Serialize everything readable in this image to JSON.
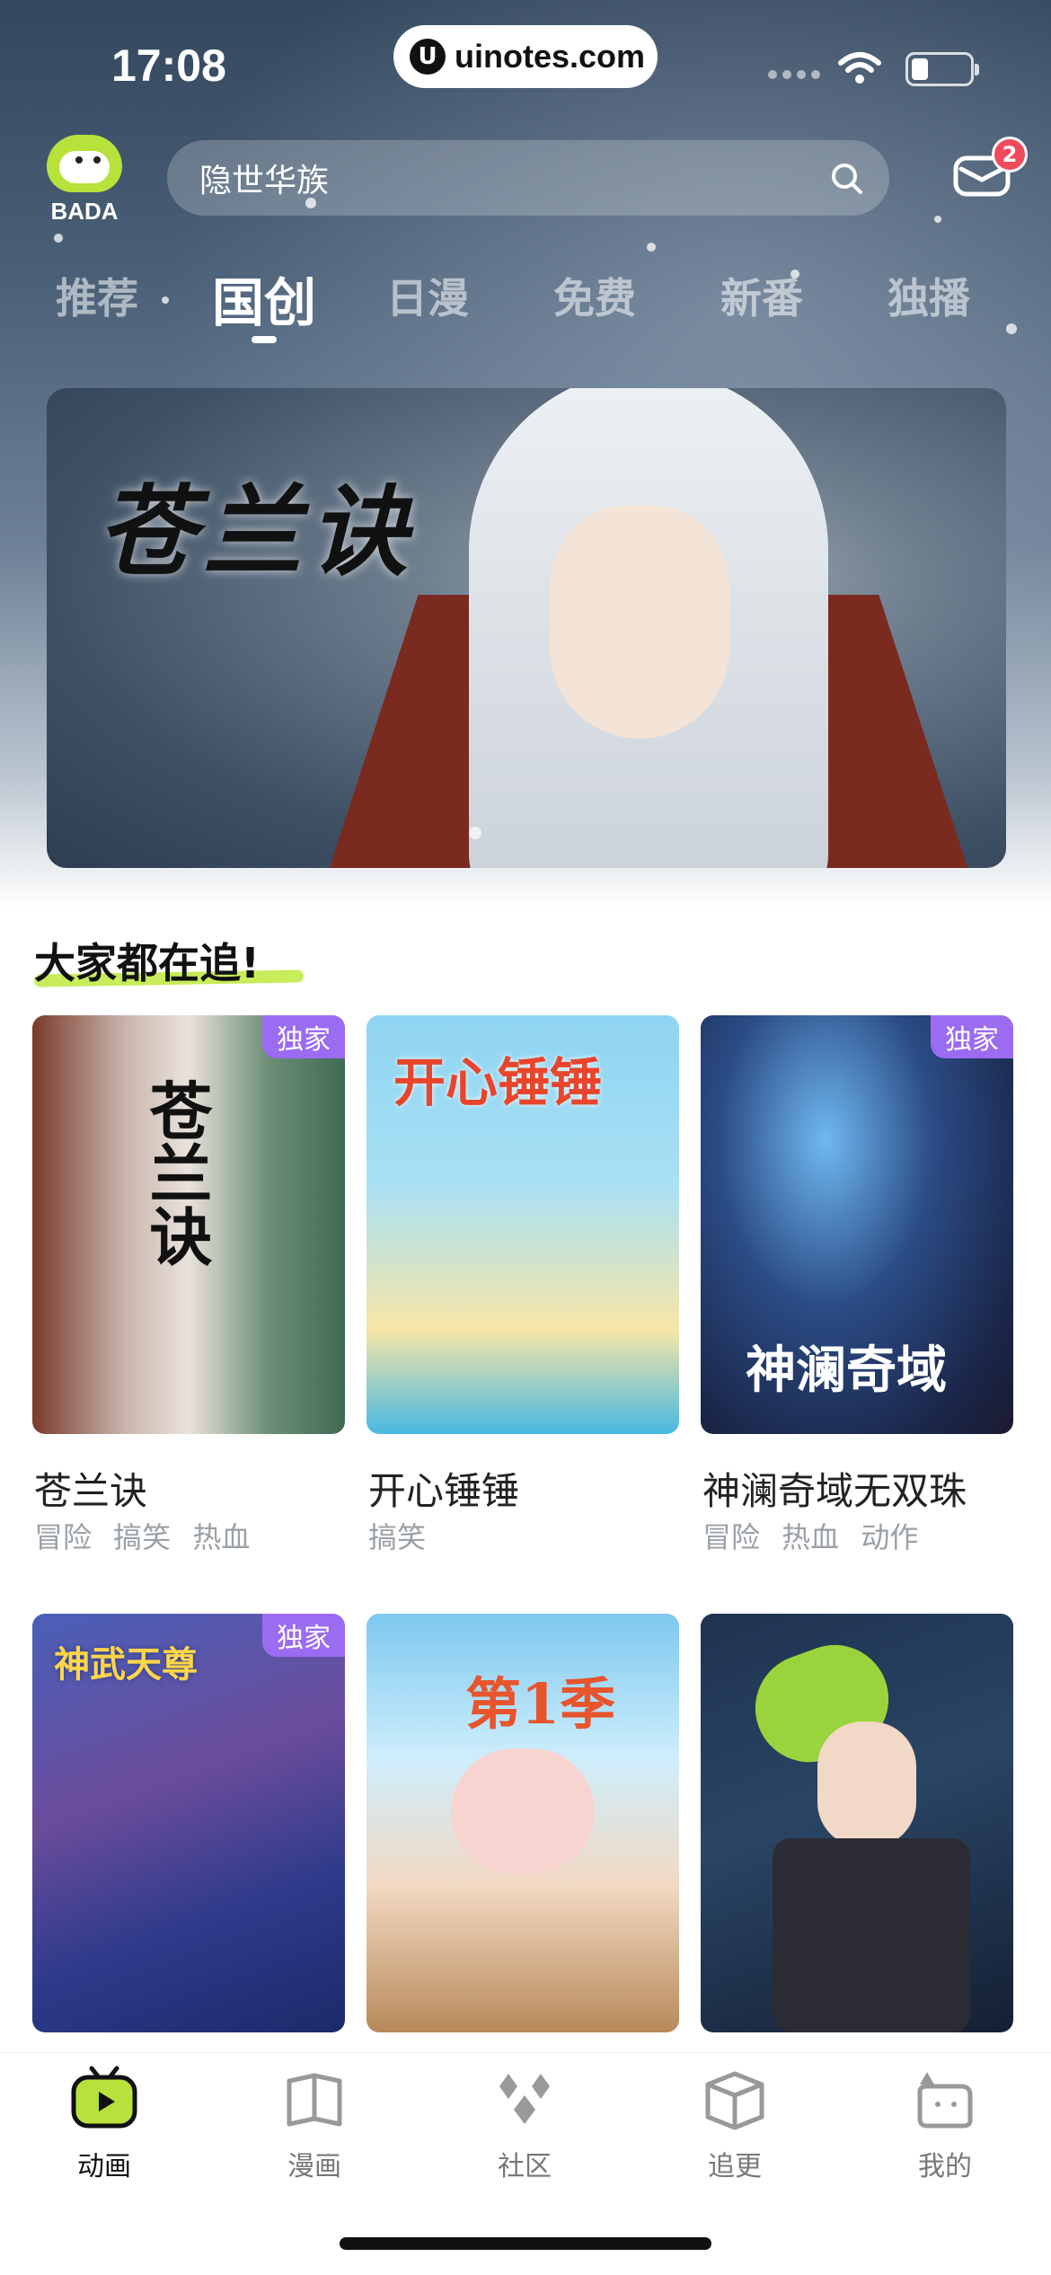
{
  "status_bar": {
    "time": "17:08",
    "watermark": "uinotes.com"
  },
  "header": {
    "logo_text": "BADA",
    "search_placeholder": "隐世华族",
    "mail_badge": "2"
  },
  "tabs": [
    {
      "label": "推荐",
      "active": false
    },
    {
      "label": "国创",
      "active": true
    },
    {
      "label": "日漫",
      "active": false
    },
    {
      "label": "免费",
      "active": false
    },
    {
      "label": "新番",
      "active": false
    },
    {
      "label": "独播",
      "active": false
    }
  ],
  "banner": {
    "title": "苍兰诀"
  },
  "section": {
    "title": "大家都在追!"
  },
  "cards": [
    {
      "title": "苍兰诀",
      "tags": "冒险 搞笑 热血",
      "badge": "独家",
      "cover_text": "苍兰诀"
    },
    {
      "title": "开心锤锤",
      "tags": "搞笑",
      "badge": "",
      "cover_text": "开心锤锤"
    },
    {
      "title": "神澜奇域无双珠",
      "tags": "冒险 热血 动作",
      "badge": "独家",
      "cover_text": "神澜奇域"
    },
    {
      "title": "",
      "tags": "",
      "badge": "独家",
      "cover_text": "神武天尊"
    },
    {
      "title": "",
      "tags": "",
      "badge": "",
      "cover_text": "第1季"
    },
    {
      "title": "",
      "tags": "",
      "badge": "",
      "cover_text": ""
    }
  ],
  "bottom_nav": [
    {
      "label": "动画",
      "icon": "tv-icon",
      "active": true
    },
    {
      "label": "漫画",
      "icon": "comic-book-icon",
      "active": false
    },
    {
      "label": "社区",
      "icon": "community-icon",
      "active": false
    },
    {
      "label": "追更",
      "icon": "box-icon",
      "active": false
    },
    {
      "label": "我的",
      "icon": "profile-icon",
      "active": false
    }
  ],
  "colors": {
    "accent_green": "#b7e23b",
    "badge_purple": "#9b6bf2",
    "notification_red": "#f04a5d",
    "highlight_green": "#c8ec5a"
  }
}
